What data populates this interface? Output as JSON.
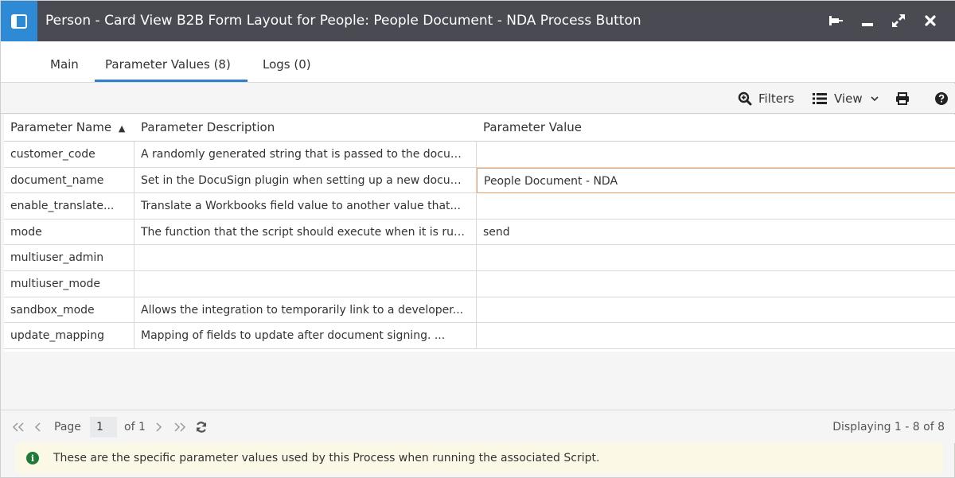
{
  "window": {
    "title": "Person - Card View B2B Form Layout for People: People Document - NDA Process Button",
    "icons": [
      "layout-panel-icon",
      "pin-icon",
      "minimize-icon",
      "maximize-icon",
      "close-icon"
    ]
  },
  "tabs": [
    {
      "label": "Main",
      "active": false
    },
    {
      "label": "Parameter Values (8)",
      "active": true
    },
    {
      "label": "Logs (0)",
      "active": false
    }
  ],
  "toolbar": {
    "filters_label": "Filters",
    "view_label": "View"
  },
  "grid": {
    "columns": [
      "Parameter Name",
      "Parameter Description",
      "Parameter Value"
    ],
    "sort_indicator": "▲",
    "rows": [
      {
        "name": "customer_code",
        "description": "A randomly generated string that is passed to the document...",
        "value": ""
      },
      {
        "name": "document_name",
        "description": "Set in the DocuSign plugin when setting up a new document...",
        "value": "People Document - NDA"
      },
      {
        "name": "enable_translate...",
        "description": "Translate a Workbooks field value to another value that...",
        "value": ""
      },
      {
        "name": "mode",
        "description": "The function that the script should execute when it is run...",
        "value": "send"
      },
      {
        "name": "multiuser_admin",
        "description": "",
        "value": ""
      },
      {
        "name": "multiuser_mode",
        "description": "",
        "value": ""
      },
      {
        "name": "sandbox_mode",
        "description": "Allows the integration to temporarily link to a developer...",
        "value": ""
      },
      {
        "name": "update_mapping",
        "description": "Mapping of fields to update after document signing. ...",
        "value": ""
      }
    ]
  },
  "pager": {
    "page_label": "Page",
    "page_value": "1",
    "of_label": "of 1",
    "displaying": "Displaying 1 - 8 of 8"
  },
  "info": {
    "text": "These are the specific parameter values used by this Process when running the associated Script."
  },
  "colors": {
    "titlebar": "#4a4a52",
    "accent": "#2f8ad6",
    "selected_border": "#e8a060",
    "info_bg": "#fbf8e6",
    "info_icon": "#1f7a3a"
  }
}
